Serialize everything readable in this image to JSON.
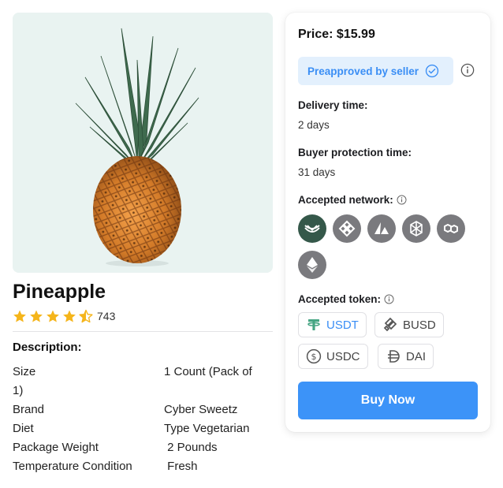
{
  "product": {
    "title": "Pineapple",
    "rating": 4.5,
    "review_count": "743",
    "description_heading": "Description:",
    "specs": [
      {
        "key": "Size",
        "value": "1 Count (Pack of"
      },
      {
        "key": "1)",
        "value": ""
      },
      {
        "key": "Brand",
        "value": "Cyber Sweetz"
      },
      {
        "key": "Diet",
        "value": "Type Vegetarian"
      },
      {
        "key": "Package Weight",
        "value": " 2 Pounds"
      },
      {
        "key": "Temperature Condition",
        "value": " Fresh"
      }
    ]
  },
  "purchase": {
    "price_label": "Price: $15.99",
    "preapproved_label": "Preapproved by seller",
    "delivery_label": "Delivery time:",
    "delivery_value": "2 days",
    "protection_label": "Buyer protection time:",
    "protection_value": "31 days",
    "network_label": "Accepted network:",
    "networks": [
      "Celo",
      "BNB Chain",
      "Avalanche",
      "Fantom",
      "Polygon",
      "Ethereum"
    ],
    "token_label": "Accepted token:",
    "tokens": [
      {
        "name": "USDT",
        "selected": true
      },
      {
        "name": "BUSD",
        "selected": false
      },
      {
        "name": "USDC",
        "selected": false
      },
      {
        "name": "DAI",
        "selected": false
      }
    ],
    "buy_label": "Buy Now"
  },
  "colors": {
    "accent": "#3c93f8",
    "star": "#f5b51b",
    "network_selected": "#35584a",
    "network_default": "#7a7a7e"
  }
}
